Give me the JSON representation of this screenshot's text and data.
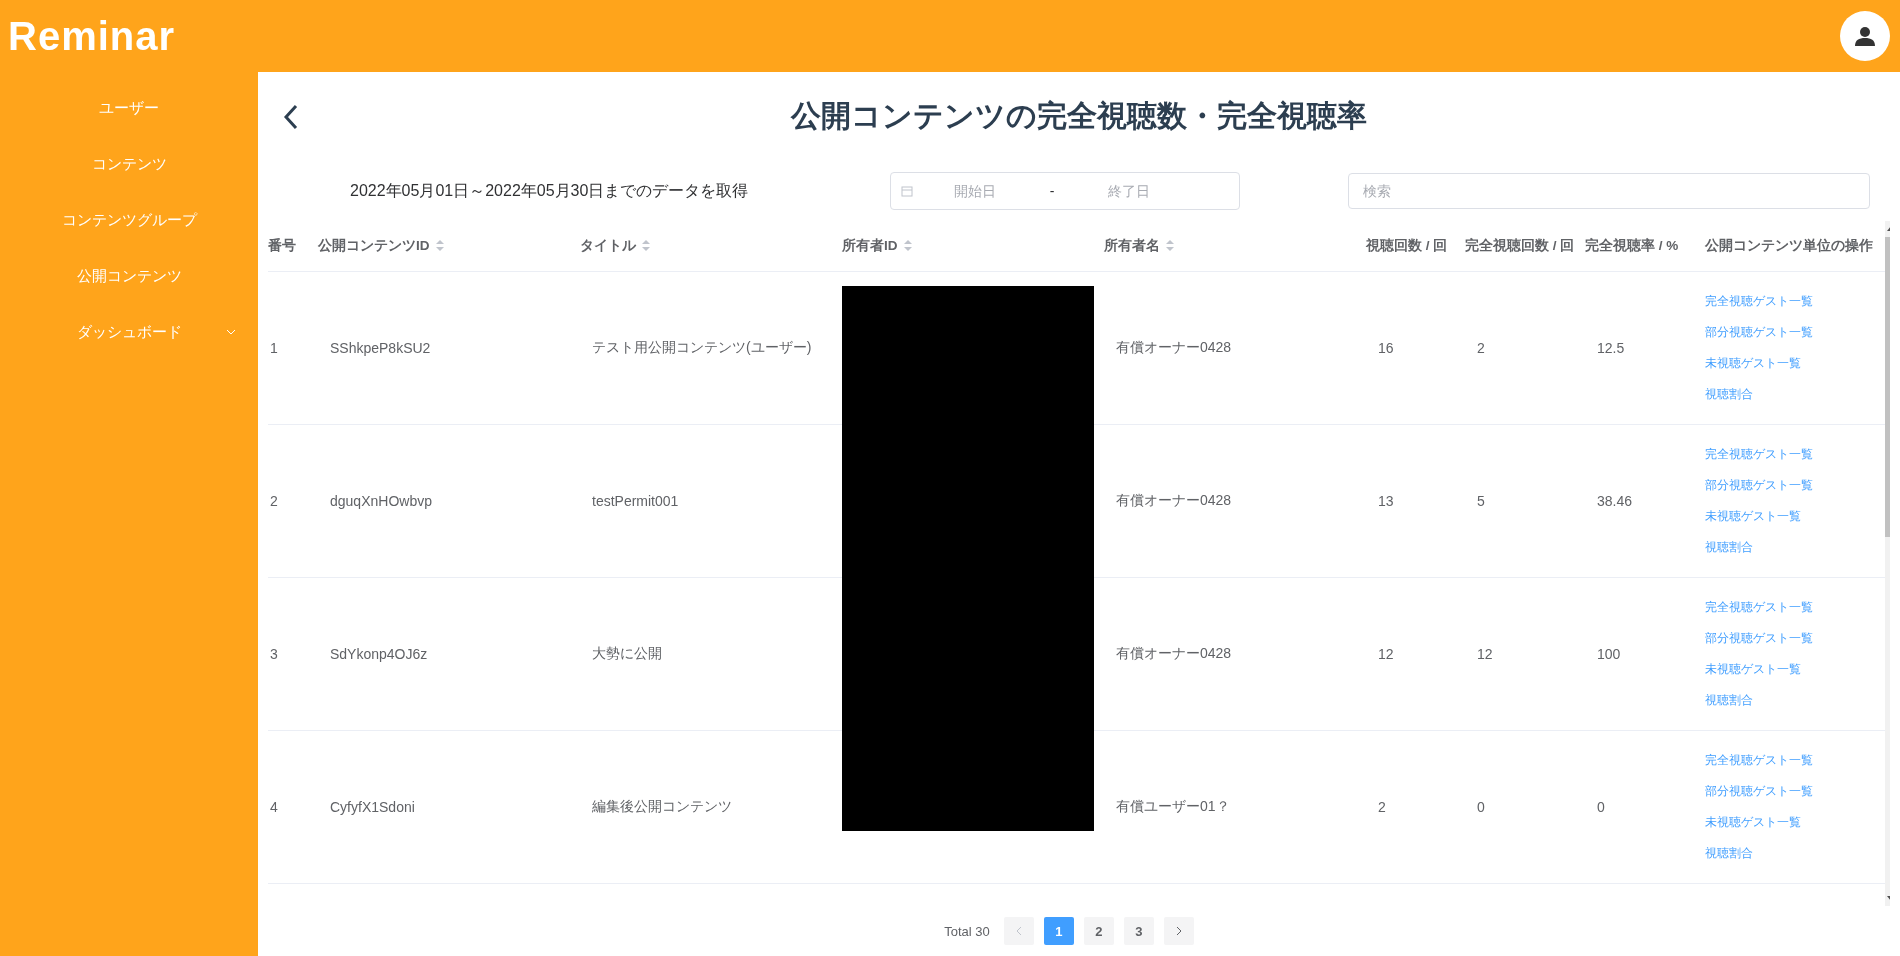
{
  "header": {
    "logo": "Reminar"
  },
  "sidebar": {
    "items": [
      {
        "label": "ユーザー",
        "has_submenu": false
      },
      {
        "label": "コンテンツ",
        "has_submenu": false
      },
      {
        "label": "コンテンツグループ",
        "has_submenu": false
      },
      {
        "label": "公開コンテンツ",
        "has_submenu": false
      },
      {
        "label": "ダッシュボード",
        "has_submenu": true
      }
    ]
  },
  "page": {
    "title": "公開コンテンツの完全視聴数・完全視聴率",
    "range_text": "2022年05月01日～2022年05月30日までのデータを取得",
    "date_range": {
      "start_placeholder": "開始日",
      "separator": "-",
      "end_placeholder": "終了日"
    },
    "search": {
      "placeholder": "検索"
    }
  },
  "table": {
    "columns": [
      {
        "label": "番号",
        "sortable": false
      },
      {
        "label": "公開コンテンツID",
        "sortable": true
      },
      {
        "label": "タイトル",
        "sortable": true
      },
      {
        "label": "所有者ID",
        "sortable": true
      },
      {
        "label": "所有者名",
        "sortable": true
      },
      {
        "label": "視聴回数 / 回",
        "sortable": false
      },
      {
        "label": "完全視聴回数 / 回",
        "sortable": false
      },
      {
        "label": "完全視聴率 / %",
        "sortable": false
      },
      {
        "label": "公開コンテンツ単位の操作",
        "sortable": false
      }
    ],
    "rows": [
      {
        "no": "1",
        "content_id": "SShkpeP8kSU2",
        "title": "テスト用公開コンテンツ(ユーザー)",
        "owner_name": "有償オーナー0428",
        "views": "16",
        "complete_views": "2",
        "complete_rate": "12.5",
        "actions": [
          "完全視聴ゲスト一覧",
          "部分視聴ゲスト一覧",
          "未視聴ゲスト一覧",
          "視聴割合"
        ]
      },
      {
        "no": "2",
        "content_id": "dguqXnHOwbvp",
        "title": "testPermit001",
        "owner_name": "有償オーナー0428",
        "views": "13",
        "complete_views": "5",
        "complete_rate": "38.46",
        "actions": [
          "完全視聴ゲスト一覧",
          "部分視聴ゲスト一覧",
          "未視聴ゲスト一覧",
          "視聴割合"
        ]
      },
      {
        "no": "3",
        "content_id": "SdYkonp4OJ6z",
        "title": "大勢に公開",
        "owner_name": "有償オーナー0428",
        "views": "12",
        "complete_views": "12",
        "complete_rate": "100",
        "actions": [
          "完全視聴ゲスト一覧",
          "部分視聴ゲスト一覧",
          "未視聴ゲスト一覧",
          "視聴割合"
        ]
      },
      {
        "no": "4",
        "content_id": "CyfyfX1Sdoni",
        "title": "編集後公開コンテンツ",
        "owner_name": "有償ユーザー01？",
        "views": "2",
        "complete_views": "0",
        "complete_rate": "0",
        "actions": [
          "完全視聴ゲスト一覧",
          "部分視聴ゲスト一覧",
          "未視聴ゲスト一覧",
          "視聴割合"
        ]
      }
    ]
  },
  "pagination": {
    "total": "Total 30",
    "prev_disabled": true,
    "pages": [
      {
        "label": "1",
        "selected": true
      },
      {
        "label": "2",
        "selected": false
      },
      {
        "label": "3",
        "selected": false
      }
    ],
    "next_disabled": false
  }
}
